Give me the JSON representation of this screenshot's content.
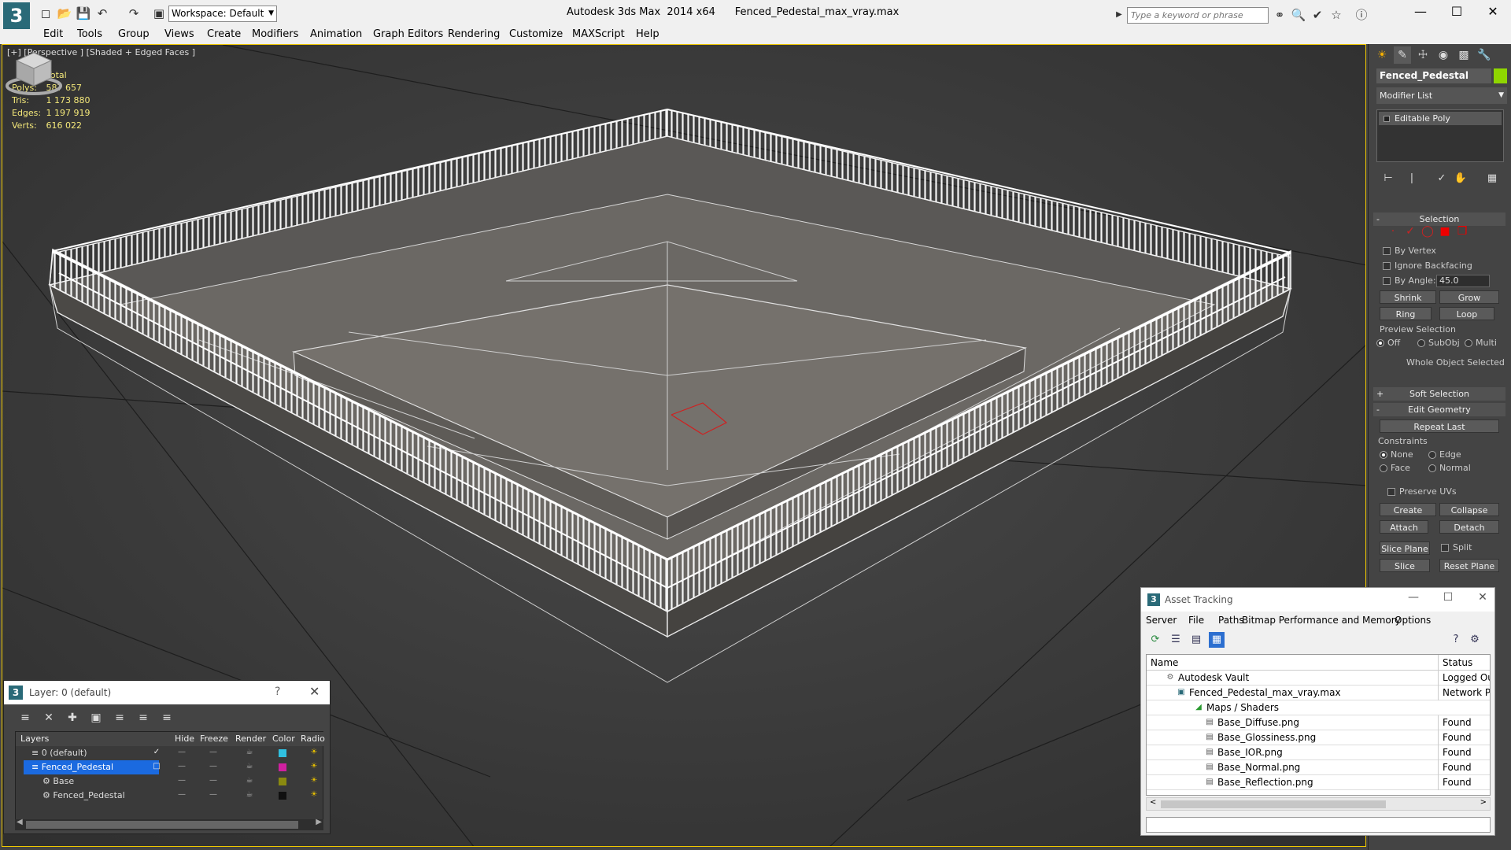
{
  "titlebar": {
    "workspace": "Workspace: Default",
    "app_title": "Autodesk 3ds Max  2014 x64",
    "file_name": "Fenced_Pedestal_max_vray.max",
    "search_placeholder": "Type a keyword or phrase"
  },
  "menu": [
    "Edit",
    "Tools",
    "Group",
    "Views",
    "Create",
    "Modifiers",
    "Animation",
    "Graph Editors",
    "Rendering",
    "Customize",
    "MAXScript",
    "Help"
  ],
  "viewport": {
    "label": "[+] [Perspective ] [Shaded + Edged Faces ]",
    "stats_header": "Total",
    "stats": [
      {
        "label": "Polys:",
        "value": "587 657"
      },
      {
        "label": "Tris:",
        "value": "1 173 880"
      },
      {
        "label": "Edges:",
        "value": "1 197 919"
      },
      {
        "label": "Verts:",
        "value": "616 022"
      }
    ]
  },
  "command_panel": {
    "object_name": "Fenced_Pedestal",
    "object_color": "#8fd600",
    "modifier_list": "Modifier List",
    "modifier_stack": [
      "Editable Poly"
    ],
    "selection": {
      "header": "Selection",
      "by_vertex": "By Vertex",
      "ignore_backfacing": "Ignore Backfacing",
      "by_angle": "By Angle:",
      "angle_value": "45.0",
      "shrink": "Shrink",
      "grow": "Grow",
      "ring": "Ring",
      "loop": "Loop",
      "preview_selection": "Preview Selection",
      "off": "Off",
      "subobj": "SubObj",
      "multi": "Multi",
      "status": "Whole Object Selected"
    },
    "soft_selection": "Soft Selection",
    "edit_geometry": {
      "header": "Edit Geometry",
      "repeat_last": "Repeat Last",
      "constraints": "Constraints",
      "none": "None",
      "edge": "Edge",
      "face": "Face",
      "normal": "Normal",
      "preserve_uvs": "Preserve UVs",
      "create": "Create",
      "collapse": "Collapse",
      "attach": "Attach",
      "detach": "Detach",
      "slice_plane": "Slice Plane",
      "split": "Split",
      "slice": "Slice",
      "reset_plane": "Reset Plane"
    }
  },
  "layer_dialog": {
    "title": "Layer: 0 (default)",
    "columns": {
      "layers": "Layers",
      "hide": "Hide",
      "freeze": "Freeze",
      "render": "Render",
      "color": "Color",
      "radio": "Radio"
    },
    "rows": [
      {
        "name": "0 (default)",
        "color": "#30c0e0"
      },
      {
        "name": "Fenced_Pedestal",
        "color": "#d020a0"
      },
      {
        "name": "Base",
        "color": "#8a8a10"
      },
      {
        "name": "Fenced_Pedestal",
        "color": "#101010"
      }
    ]
  },
  "asset_tracking": {
    "title": "Asset Tracking",
    "menu": [
      "Server",
      "File",
      "Paths",
      "Bitmap Performance and Memory",
      "Options"
    ],
    "columns": {
      "name": "Name",
      "status": "Status"
    },
    "rows": [
      {
        "name": "Autodesk Vault",
        "status": "Logged Out"
      },
      {
        "name": "Fenced_Pedestal_max_vray.max",
        "status": "Network Pat"
      },
      {
        "name": "Maps / Shaders",
        "status": ""
      },
      {
        "name": "Base_Diffuse.png",
        "status": "Found"
      },
      {
        "name": "Base_Glossiness.png",
        "status": "Found"
      },
      {
        "name": "Base_IOR.png",
        "status": "Found"
      },
      {
        "name": "Base_Normal.png",
        "status": "Found"
      },
      {
        "name": "Base_Reflection.png",
        "status": "Found"
      }
    ]
  },
  "icons": {
    "app": "3ds-max-logo",
    "window": [
      "minimize-icon",
      "maximize-icon",
      "close-icon"
    ]
  },
  "colors": {
    "viewport_border": "#f0c800",
    "stats_text": "#f4e87a",
    "layer_selection": "#1b6ae0"
  }
}
